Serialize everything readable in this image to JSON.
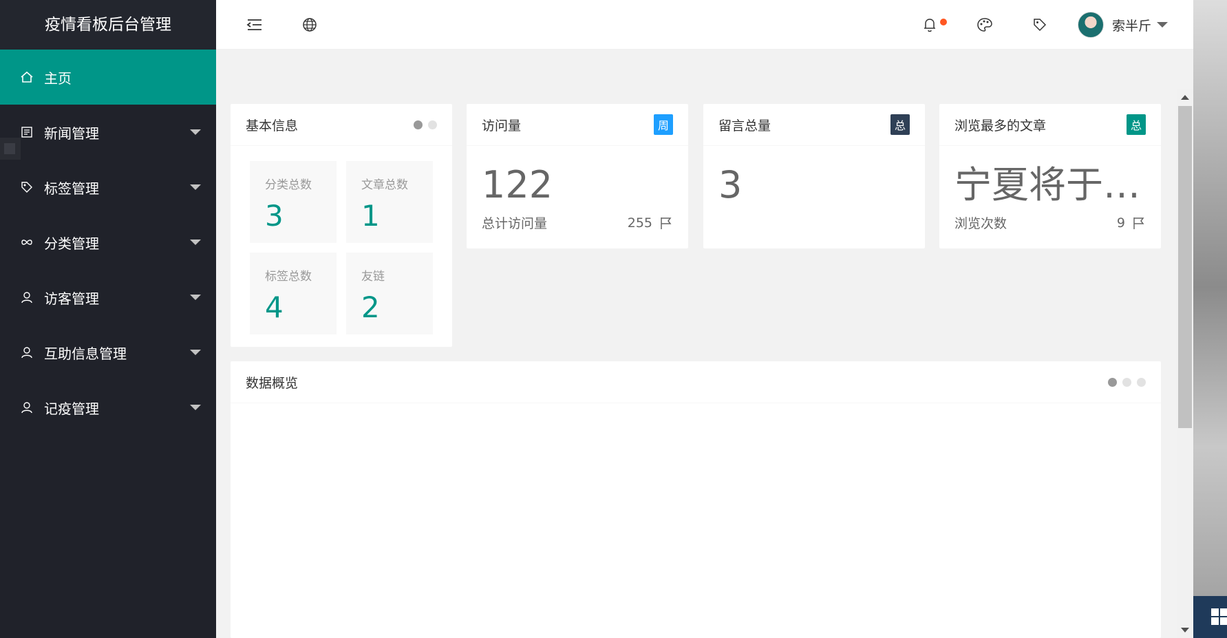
{
  "sidebar": {
    "title": "疫情看板后台管理",
    "items": [
      {
        "label": "主页"
      },
      {
        "label": "新闻管理"
      },
      {
        "label": "标签管理"
      },
      {
        "label": "分类管理"
      },
      {
        "label": "访客管理"
      },
      {
        "label": "互助信息管理"
      },
      {
        "label": "记疫管理"
      }
    ]
  },
  "header": {
    "username": "索半斤"
  },
  "basic_info": {
    "title": "基本信息",
    "tiles": [
      {
        "label": "分类总数",
        "value": "3"
      },
      {
        "label": "文章总数",
        "value": "1"
      },
      {
        "label": "标签总数",
        "value": "4"
      },
      {
        "label": "友链",
        "value": "2"
      }
    ]
  },
  "visits": {
    "title": "访问量",
    "badge": "周",
    "value": "122",
    "sub_label": "总计访问量",
    "sub_value": "255"
  },
  "messages": {
    "title": "留言总量",
    "badge": "总",
    "value": "3"
  },
  "top_article": {
    "title": "浏览最多的文章",
    "badge": "总",
    "value": "宁夏将于…",
    "sub_label": "浏览次数",
    "sub_value": "9"
  },
  "overview": {
    "title": "数据概览"
  },
  "colors": {
    "accent": "#009688",
    "sidebar": "#20222a",
    "badge_blue": "#1e9fff",
    "badge_dark": "#2f4056",
    "notify": "#ff5722"
  }
}
